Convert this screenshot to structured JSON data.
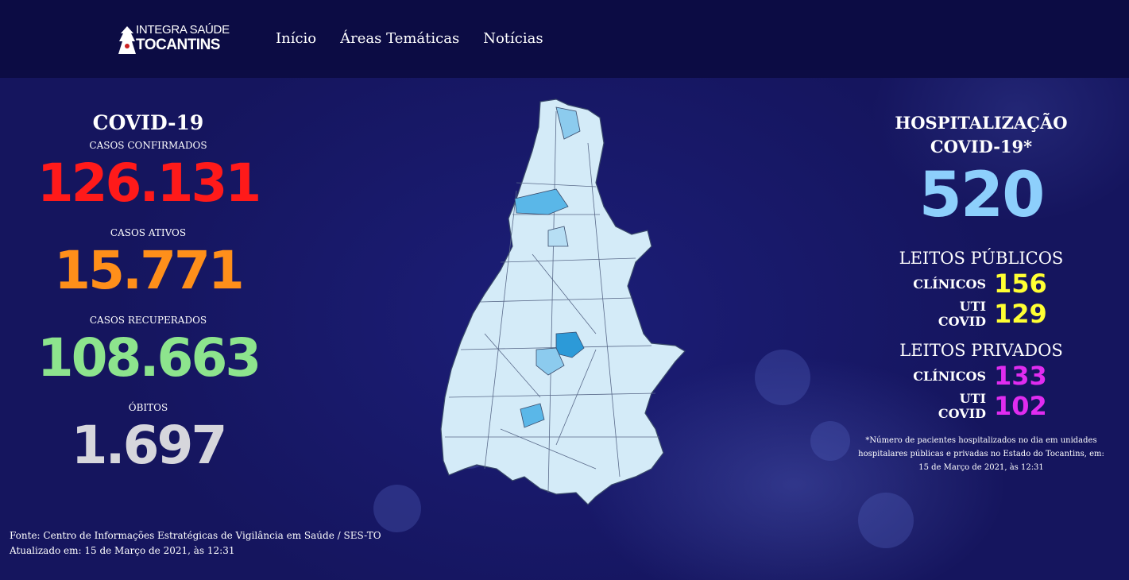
{
  "header": {
    "logo_line1": "INTEGRA SAÚDE",
    "logo_line2": "TOCANTINS",
    "nav": [
      "Início",
      "Áreas Temáticas",
      "Notícias"
    ]
  },
  "covid": {
    "title": "COVID-19",
    "stats": [
      {
        "label": "CASOS CONFIRMADOS",
        "value": "126.131",
        "color": "#ff1a1a"
      },
      {
        "label": "CASOS ATIVOS",
        "value": "15.771",
        "color": "#ff8f1a"
      },
      {
        "label": "CASOS RECUPERADOS",
        "value": "108.663",
        "color": "#8de48d"
      },
      {
        "label": "ÓBITOS",
        "value": "1.697",
        "color": "#d6d6dc"
      }
    ]
  },
  "hospital": {
    "title_line1": "HOSPITALIZAÇÃO",
    "title_line2": "COVID-19*",
    "value": "520",
    "public": {
      "title": "LEITOS PÚBLICOS",
      "clinical_label": "CLÍNICOS",
      "clinical_value": "156",
      "icu_label": "UTI COVID",
      "icu_value": "129"
    },
    "private": {
      "title": "LEITOS PRIVADOS",
      "clinical_label": "CLÍNICOS",
      "clinical_value": "133",
      "icu_label": "UTI COVID",
      "icu_value": "102"
    },
    "note": "*Número de pacientes hospitalizados no dia em unidades hospitalares públicas e privadas no Estado do Tocantins, em: 15 de Março de 2021, às 12:31"
  },
  "footer": {
    "source": "Fonte: Centro de Informações Estratégicas de Vigilância em Saúde / SES-TO",
    "updated": "Atualizado em: 15 de Março de 2021, às 12:31"
  },
  "colors": {
    "confirmed": "#ff1a1a",
    "active": "#ff8f1a",
    "recovered": "#8de48d",
    "deaths": "#d6d6dc",
    "hospital": "#8dcffc",
    "public": "#ffff33",
    "private": "#e02cf0"
  },
  "map": {
    "icon": "tocantins-state-map"
  }
}
